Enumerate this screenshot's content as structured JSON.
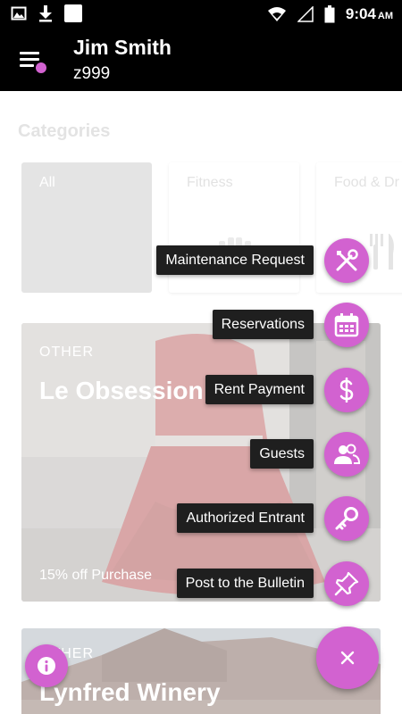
{
  "status_bar": {
    "time": "9:04",
    "ampm": "AM",
    "icons": [
      "gallery-icon",
      "download-icon",
      "square-icon",
      "wifi-icon",
      "signal-icon",
      "battery-icon"
    ]
  },
  "header": {
    "name": "Jim Smith",
    "user_id": "z999",
    "menu_icon": "menu-icon"
  },
  "categories": {
    "title": "Categories",
    "items": [
      {
        "label": "All"
      },
      {
        "label": "Fitness"
      },
      {
        "label": "Food & Dr"
      }
    ]
  },
  "deals": [
    {
      "category": "OTHER",
      "title": "Le Obsession",
      "offer": "15% off Purchase"
    },
    {
      "category": "OTHER",
      "title": "Lynfred Winery"
    }
  ],
  "speed_dial": {
    "items": [
      {
        "label": "Maintenance Request",
        "icon": "tools-icon"
      },
      {
        "label": "Reservations",
        "icon": "calendar-icon"
      },
      {
        "label": "Rent Payment",
        "icon": "dollar-icon"
      },
      {
        "label": "Guests",
        "icon": "people-icon"
      },
      {
        "label": "Authorized Entrant",
        "icon": "key-icon"
      },
      {
        "label": "Post to the Bulletin",
        "icon": "pushpin-icon"
      }
    ],
    "close_icon": "close-icon"
  },
  "info_icon": "info-icon",
  "colors": {
    "accent": "#d262d0",
    "appbar": "#000000",
    "tooltip": "#1f1f1f"
  }
}
